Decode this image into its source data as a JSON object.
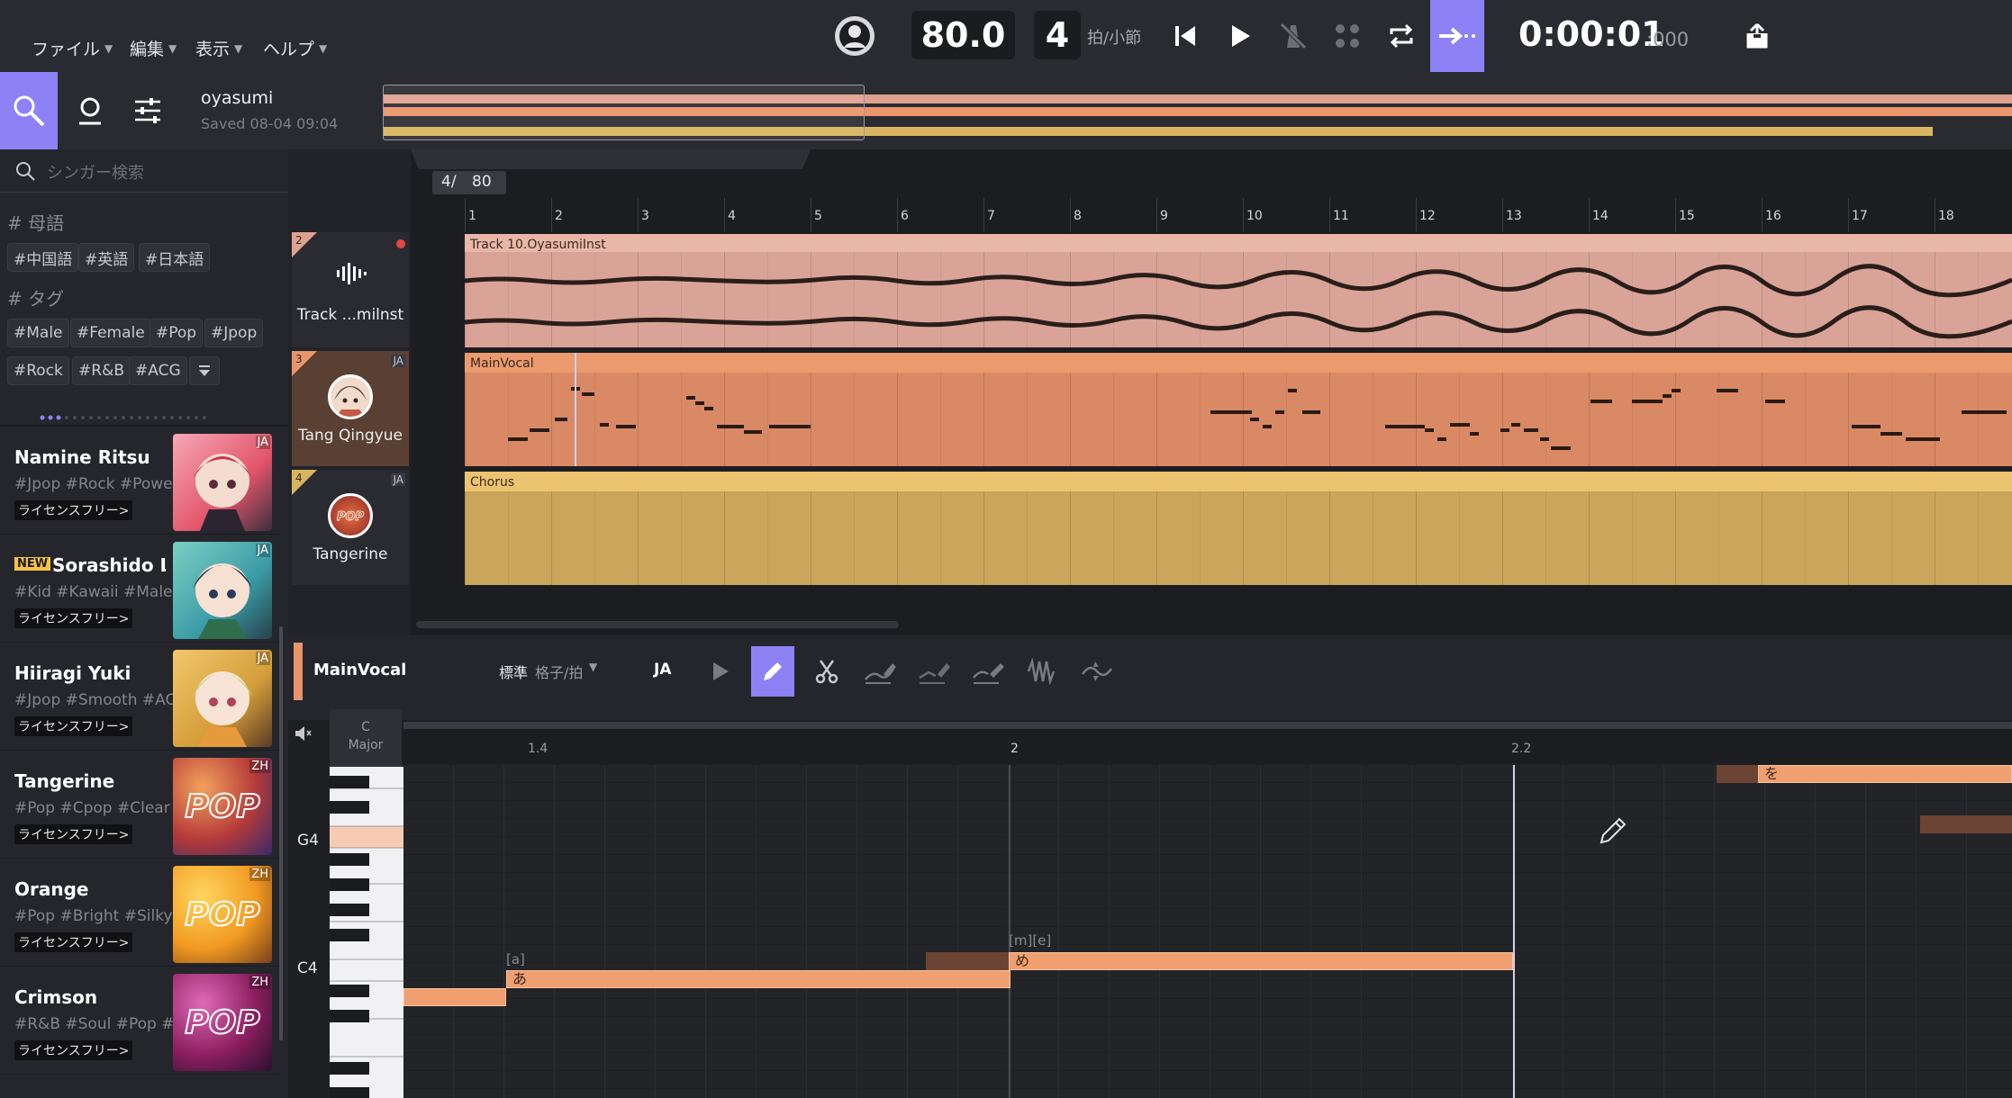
{
  "menu": [
    "ファイル",
    "編集",
    "表示",
    "ヘルプ"
  ],
  "transport": {
    "tempo": "80.0",
    "beats": "4",
    "beats_unit": "拍/小節",
    "time_main": "0:00:01",
    "time_ms": ":000"
  },
  "project": {
    "name": "oyasumi",
    "saved": "Saved 08-04 09:04"
  },
  "search": {
    "placeholder": "シンガー検索"
  },
  "filters": {
    "lang_header": "# 母語",
    "lang_tags": [
      "#中国語",
      "#英語",
      "#日本語"
    ],
    "tag_header": "# タグ",
    "tags_row1": [
      "#Male",
      "#Female",
      "#Pop",
      "#Jpop"
    ],
    "tags_row2": [
      "#Rock",
      "#R&B",
      "#ACG"
    ]
  },
  "singers": [
    {
      "name": "Namine Ritsu",
      "tags": "#Jpop #Rock #Powe",
      "license": "ライセンスフリー>",
      "lang": "JA",
      "new": false
    },
    {
      "name": "Sorashido Lo",
      "tags": "#Kid #Kawaii #Male",
      "license": "ライセンスフリー>",
      "lang": "JA",
      "new": true,
      "new_label": "NEW"
    },
    {
      "name": "Hiiragi Yuki",
      "tags": "#Jpop #Smooth #AC",
      "license": "ライセンスフリー>",
      "lang": "JA",
      "new": false
    },
    {
      "name": "Tangerine",
      "tags": "#Pop #Cpop #Clear",
      "license": "ライセンスフリー>",
      "lang": "ZH",
      "new": false
    },
    {
      "name": "Orange",
      "tags": "#Pop #Bright #Silky",
      "license": "ライセンスフリー>",
      "lang": "ZH",
      "new": false
    },
    {
      "name": "Crimson",
      "tags": "#R&B #Soul #Pop #r",
      "license": "ライセンスフリー>",
      "lang": "ZH",
      "new": false
    }
  ],
  "timeline": {
    "time_sig": "4/",
    "tempo": "80",
    "bars": [
      "1",
      "2",
      "3",
      "4",
      "5",
      "6",
      "7",
      "8",
      "9",
      "10",
      "11",
      "12",
      "13",
      "14",
      "15",
      "16",
      "17",
      "18"
    ]
  },
  "tracks": [
    {
      "index": "2",
      "name": "Track ...milnst",
      "clip": "Track 10.OyasumiInst",
      "color": "#e0a18f"
    },
    {
      "index": "3",
      "name": "Tang Qingyue",
      "clip": "MainVocal",
      "color": "#e9946a",
      "lang": "JA"
    },
    {
      "index": "4",
      "name": "Tangerine",
      "clip": "Chorus",
      "color": "#d9b460",
      "lang": "JA"
    }
  ],
  "editor": {
    "track": "MainVocal",
    "grid": "標準",
    "grid_unit": "格子/拍",
    "lang": "JA",
    "key_top": "C",
    "key_bottom": "Major",
    "markers": [
      "1.4",
      "2",
      "2.2"
    ],
    "pitch_labels": [
      "G4",
      "C4"
    ],
    "notes": [
      {
        "phoneme": "[a]",
        "lyric": "あ"
      },
      {
        "phoneme": "[m][e]",
        "lyric": "め"
      },
      {
        "phoneme": "",
        "lyric": "を"
      }
    ]
  },
  "colors": {
    "accent": "#8d82f5",
    "audio": "#e0a18f",
    "vocal": "#e9946a",
    "chorus": "#d9b460",
    "note": "#f0a070"
  }
}
